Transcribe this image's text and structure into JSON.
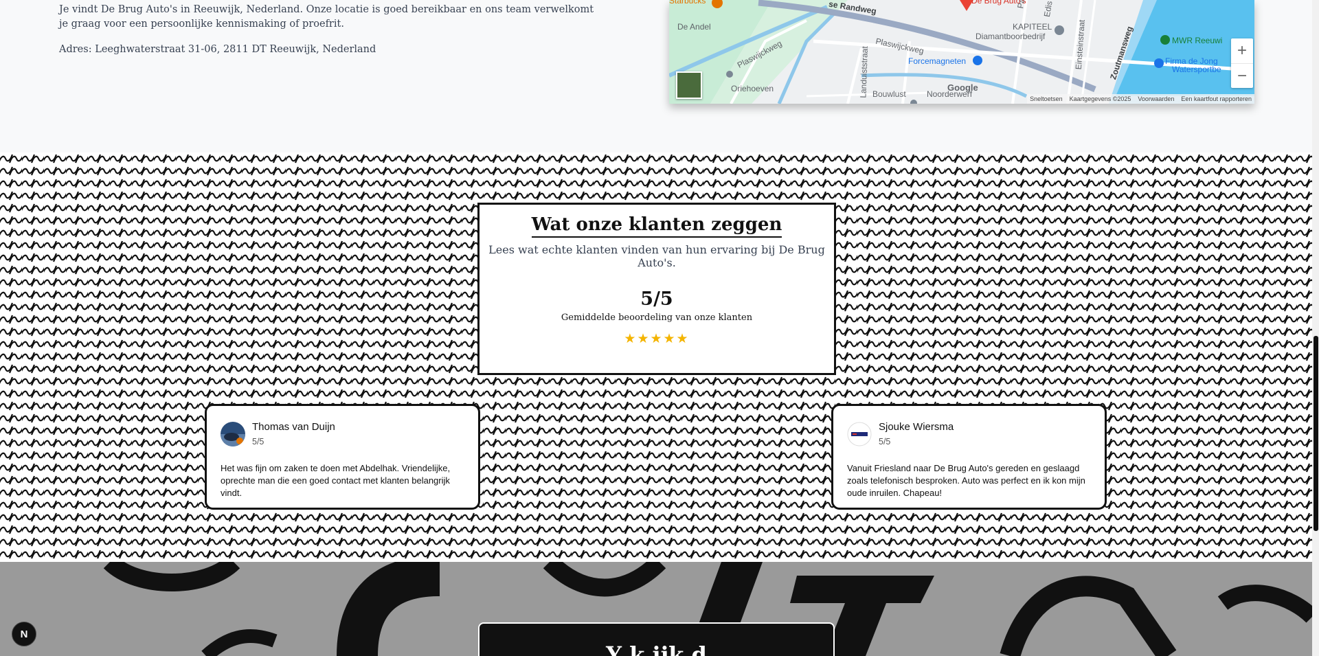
{
  "location": {
    "intro": "Je vindt De Brug Auto's in Reeuwijk, Nederland. Onze locatie is goed bereikbaar en ons team verwelkomt je graag voor een persoonlijke kennismaking of proefrit.",
    "address": "Adres: Leeghwaterstraat 31-06, 2811 DT Reeuwijk, Nederland"
  },
  "map": {
    "labels": {
      "starbucks": "Starbucks",
      "randweg": "se Randweg",
      "debrug": "De Brug Auto's",
      "kapiteel": "KAPITEEL",
      "diamant": "Diamantboorbedrijf",
      "deandel": "De Andel",
      "plaswijckweg1": "Plaswijckweg",
      "plaswijckweg2": "Plaswijckweg",
      "forcemagneten": "Forcemagneten",
      "landuist": "Landuiststraat",
      "einstein": "Einsteinstraat",
      "zoutman": "Zoutmansweg",
      "mwr": "MWR Reeuwi",
      "firma": "Firma de Jong",
      "waters": "Watersportbe",
      "oriehoeven": "Oriehoeven",
      "bouwlust": "Bouwlust",
      "noorderwerf": "Noorderwerf",
      "edisonstraat": "Edis",
      "pasc": "Pasc"
    },
    "google": "Google",
    "zoom_in": "+",
    "zoom_out": "−",
    "attribution": [
      "Sneltoetsen",
      "Kaartgegevens ©2025",
      "Voorwaarden",
      "Een kaartfout rapporteren"
    ]
  },
  "reviews_section": {
    "title": "Wat onze klanten zeggen",
    "subtitle": "Lees wat echte klanten vinden van hun ervaring bij De Brug Auto's.",
    "score": "5/5",
    "caption": "Gemiddelde beoordeling van onze klanten",
    "stars": "★★★★★",
    "rating_value": 5,
    "reviews": [
      {
        "name": "Thomas van Duijn",
        "score": "5/5",
        "text": "Het was fijn om zaken te doen met Abdelhak. Vriendelijke, oprechte man die een goed contact met klanten belangrijk vindt."
      },
      {
        "name": "Sjouke Wiersma",
        "score": "5/5",
        "text": "Vanuit Friesland naar De Brug Auto's gereden en geslaagd zoals telefonisch besproken. Auto was perfect en ik kon mijn oude inruilen. Chapeau!"
      }
    ]
  },
  "bottom": {
    "heading": "Y   k        ijk      d"
  },
  "badge": "N"
}
